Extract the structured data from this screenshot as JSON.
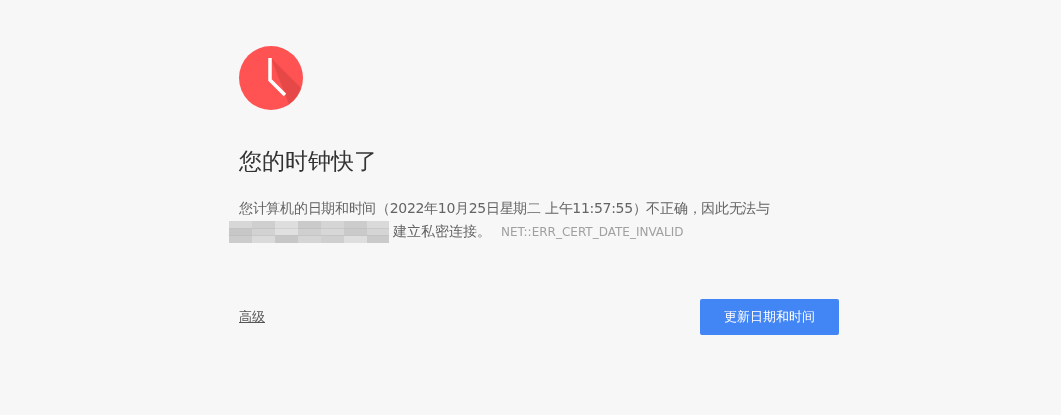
{
  "heading": "您的时钟快了",
  "message": {
    "line_1": "您计算机的日期和时间（2022年10月25日星期二 上午11:57:55）不正确，因此无法与",
    "line_2": "建立私密连接。",
    "error_code": "NET::ERR_CERT_DATE_INVALID"
  },
  "advanced_link": "高级",
  "primary_button": "更新日期和时间"
}
